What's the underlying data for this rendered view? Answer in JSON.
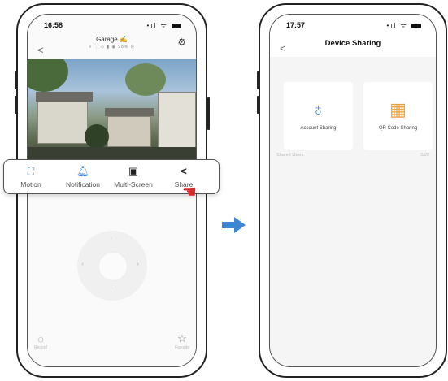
{
  "left_phone": {
    "status": {
      "time": "16:58",
      "signal": "•ıl ᯤ"
    },
    "nav": {
      "back": "<"
    },
    "camera": {
      "title": "Garage ✍",
      "subtitle": "⋄ ⋮ ◇ ▮ ◉ 98% ⊙",
      "settings_icon": "gear-icon"
    },
    "bottom_tools": [
      {
        "icon": "record-icon",
        "label": "Record"
      },
      {
        "icon": "favorite-icon",
        "label": "Favorite"
      }
    ]
  },
  "toolbar": {
    "items": [
      {
        "icon": "motion-icon",
        "label": "Motion"
      },
      {
        "icon": "bell-icon",
        "label": "Notification"
      },
      {
        "icon": "multi-screen-icon",
        "label": "Multi-Screen"
      },
      {
        "icon": "share-icon",
        "label": "Share"
      }
    ]
  },
  "right_phone": {
    "status": {
      "time": "17:57",
      "signal": "•ıl ᯤ"
    },
    "nav": {
      "back": "<",
      "title": "Device Sharing"
    },
    "options": [
      {
        "icon": "user-icon",
        "label": "Account Sharing"
      },
      {
        "icon": "qr-code-icon",
        "label": "QR Code Sharing"
      }
    ],
    "section": {
      "label": "Shared Users",
      "count": "0/20"
    }
  },
  "colors": {
    "accent_blue": "#3d86d4",
    "highlight_red": "#d62a2a",
    "qr_orange": "#e8a13a"
  }
}
